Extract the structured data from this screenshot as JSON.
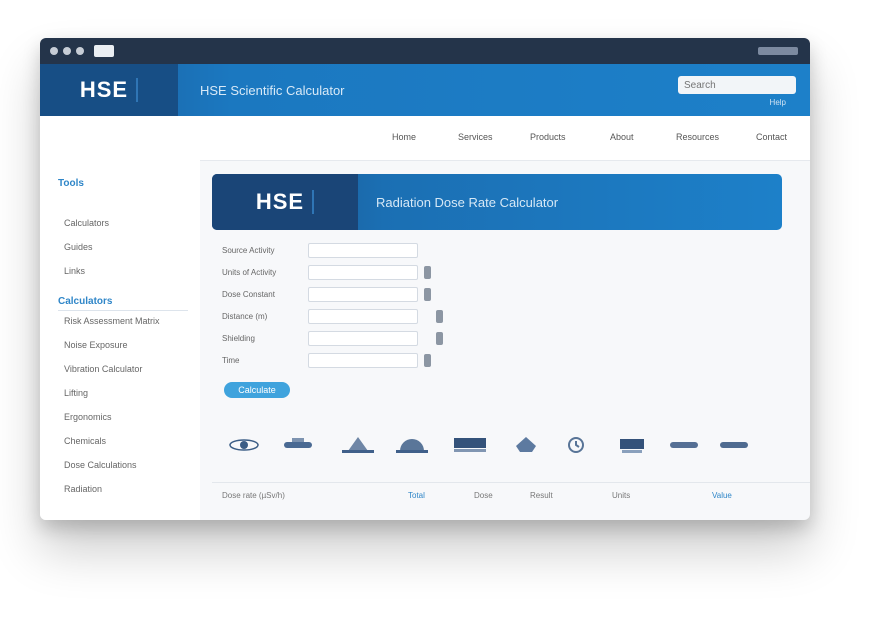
{
  "window": {
    "title": "",
    "colors": {
      "accent": "#1d80c9",
      "titlebar": "#24344a",
      "button": "#3fa3dd"
    }
  },
  "banner": {
    "logo": "HSE",
    "title": "HSE Scientific Calculator",
    "search_placeholder": "Search",
    "link": "Help"
  },
  "topnav": {
    "items": [
      "Home",
      "Services",
      "Products",
      "About",
      "Resources",
      "Contact"
    ]
  },
  "sidebar": {
    "sections": [
      {
        "heading": "Tools",
        "items": [
          "Calculators",
          "Guides",
          "Links"
        ]
      },
      {
        "heading": "Calculators",
        "items": [
          "Risk Assessment Matrix",
          "Noise Exposure",
          "Vibration Calculator",
          "Lifting",
          "Ergonomics",
          "Chemicals",
          "Dose Calculations",
          "Radiation"
        ]
      }
    ]
  },
  "main": {
    "form_banner": {
      "logo": "HSE",
      "title": "Radiation Dose Rate Calculator"
    },
    "form": {
      "rows": [
        {
          "label": "Source Activity",
          "value": ""
        },
        {
          "label": "Units of Activity",
          "value": ""
        },
        {
          "label": "Dose Constant",
          "value": ""
        },
        {
          "label": "Distance (m)",
          "value": ""
        },
        {
          "label": "Shielding",
          "value": ""
        },
        {
          "label": "Time",
          "value": ""
        }
      ],
      "submit_label": "Calculate"
    },
    "results": {
      "icons": [
        "atom-icon",
        "beaker-icon",
        "flask-icon",
        "gauge-icon",
        "ruler-icon",
        "shield-icon",
        "clock-icon",
        "chart-icon"
      ],
      "cells": [
        "Dose rate (µSv/h)",
        "Total",
        "Dose",
        "Result",
        "Units",
        "Value"
      ]
    }
  }
}
